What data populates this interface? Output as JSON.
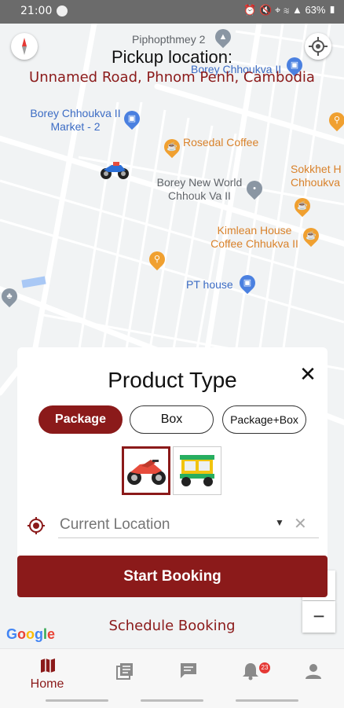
{
  "status_bar": {
    "time": "21:00",
    "battery": "63%"
  },
  "header": {
    "pickup_title": "Pickup location:",
    "pickup_address": "Unnamed Road, Phnom Penh, Cambodia"
  },
  "map": {
    "pois": [
      {
        "label": "Piphopthmey 2",
        "color": "gray"
      },
      {
        "label": "Borey Chhoukva II",
        "color": "blue"
      },
      {
        "label": "Borey Chhoukva II Market - 2",
        "color": "blue"
      },
      {
        "label": "Rosedal Coffee",
        "color": "orange"
      },
      {
        "label": "Borey New World Chhouk Va II",
        "color": "gray"
      },
      {
        "label": "Sokkhet H Chhoukva",
        "color": "orange"
      },
      {
        "label": "Kimlean House Coffee Chhukva II",
        "color": "orange"
      },
      {
        "label": "PT house",
        "color": "blue"
      }
    ],
    "google_logo": "Google",
    "zoom_out": "−"
  },
  "sheet": {
    "title": "Product Type",
    "close": "✕",
    "types": [
      {
        "label": "Package",
        "active": true
      },
      {
        "label": "Box",
        "active": false
      },
      {
        "label": "Package+Box",
        "active": false
      }
    ],
    "vehicles": [
      {
        "name": "motorbike",
        "selected": true
      },
      {
        "name": "tuk-tuk",
        "selected": false
      }
    ],
    "location_placeholder": "Current Location",
    "clear": "✕"
  },
  "actions": {
    "start_booking": "Start Booking",
    "schedule_booking": "Schedule Booking"
  },
  "nav": {
    "items": [
      {
        "label": "Home",
        "icon": "map-icon",
        "active": true
      },
      {
        "label": "",
        "icon": "bookings-icon",
        "active": false
      },
      {
        "label": "",
        "icon": "chat-icon",
        "active": false
      },
      {
        "label": "",
        "icon": "notifications-icon",
        "active": false
      },
      {
        "label": "",
        "icon": "profile-icon",
        "active": false
      }
    ],
    "notification_badge": "23"
  },
  "colors": {
    "accent": "#8b1a1a",
    "poi_blue": "#3c6cc4",
    "poi_orange": "#d9822b"
  }
}
